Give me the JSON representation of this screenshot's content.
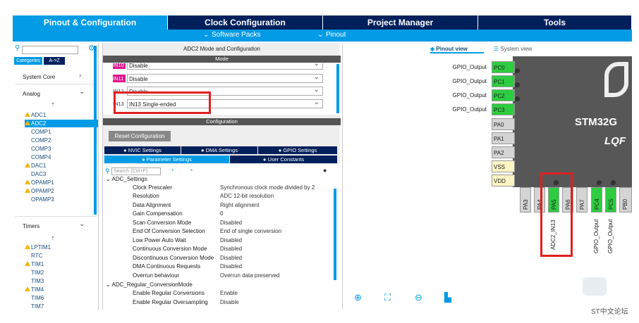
{
  "tabs": [
    "Pinout & Configuration",
    "Clock Configuration",
    "Project Manager",
    "Tools"
  ],
  "subbar": {
    "software_packs": "Software Packs",
    "pinout": "Pinout"
  },
  "left": {
    "tab_categories": "Categories",
    "tab_az": "A->Z",
    "system_core": "System Core",
    "analog": "Analog",
    "analog_items": [
      "ADC1",
      "ADC2",
      "COMP1",
      "COMP2",
      "COMP3",
      "COMP4",
      "DAC1",
      "DAC3",
      "OPAMP1",
      "OPAMP2",
      "OPAMP3"
    ],
    "timers": "Timers",
    "timer_items": [
      "LPTIM1",
      "RTC",
      "TIM1",
      "TIM2",
      "TIM3",
      "TIM4",
      "TIM6",
      "TIM7"
    ]
  },
  "mid": {
    "title": "ADC2 Mode and Configuration",
    "mode_label": "Mode",
    "mode_rows": [
      {
        "pin": "IN10",
        "value": "Disable"
      },
      {
        "pin": "IN11",
        "value": "Disable"
      },
      {
        "pin": "IN12",
        "value": "Disable"
      },
      {
        "pin": "IN13",
        "value": "IN13 Single-ended"
      }
    ],
    "config_label": "Configuration",
    "reset_btn": "Reset Configuration",
    "tabs_row1": [
      "NVIC Settings",
      "DMA Settings",
      "GPIO Settings"
    ],
    "tabs_row2": [
      "Parameter Settings",
      "User Constants"
    ],
    "search_placeholder": "Search (Ctrl+F)",
    "group1": "ADC_Settings",
    "params": [
      {
        "name": "Clock Prescaler",
        "value": "Synchronous clock mode divided by 2"
      },
      {
        "name": "Resolution",
        "value": "ADC 12-bit resolution"
      },
      {
        "name": "Data Alignment",
        "value": "Right alignment"
      },
      {
        "name": "Gain Compensation",
        "value": "0"
      },
      {
        "name": "Scan Conversion Mode",
        "value": "Disabled"
      },
      {
        "name": "End Of Conversion Selection",
        "value": "End of single conversion"
      },
      {
        "name": "Low Power Auto Wait",
        "value": "Disabled"
      },
      {
        "name": "Continuous Conversion Mode",
        "value": "Disabled"
      },
      {
        "name": "Discontinuous Conversion Mode",
        "value": "Disabled"
      },
      {
        "name": "DMA Continuous Requests",
        "value": "Disabled"
      },
      {
        "name": "Overrun behaviour",
        "value": "Overrun data preserved"
      }
    ],
    "group2": "ADC_Regular_ConversionMode",
    "params2": [
      {
        "name": "Enable Regular Conversions",
        "value": "Enable"
      },
      {
        "name": "Enable Regular Oversampling",
        "value": "Disable"
      }
    ]
  },
  "right": {
    "pinout_view": "Pinout view",
    "system_view": "System view",
    "chip_name": "STM32G",
    "chip_pkg": "LQF",
    "left_pins": [
      {
        "name": "PC0",
        "label": "GPIO_Output",
        "color": "green"
      },
      {
        "name": "PC1",
        "label": "GPIO_Output",
        "color": "green"
      },
      {
        "name": "PC2",
        "label": "GPIO_Output",
        "color": "green"
      },
      {
        "name": "PC3",
        "label": "GPIO_Output",
        "color": "green"
      },
      {
        "name": "PA0",
        "label": "",
        "color": "gray"
      },
      {
        "name": "PA1",
        "label": "",
        "color": "gray"
      },
      {
        "name": "PA2",
        "label": "",
        "color": "gray"
      },
      {
        "name": "VSS",
        "label": "",
        "color": "yellow"
      },
      {
        "name": "VDD",
        "label": "",
        "color": "yellow"
      }
    ],
    "bottom_pins": [
      {
        "name": "PA3",
        "color": "gray"
      },
      {
        "name": "PA4",
        "color": "gray"
      },
      {
        "name": "PA5",
        "color": "green"
      },
      {
        "name": "PA6",
        "color": "gray"
      },
      {
        "name": "PA7",
        "color": "gray"
      },
      {
        "name": "PC4",
        "color": "green"
      },
      {
        "name": "PC5",
        "color": "green"
      },
      {
        "name": "PB0",
        "color": "gray"
      }
    ],
    "bottom_labels": [
      "ADC2_IN13",
      "GPIO_Output",
      "GPIO_Output"
    ],
    "watermark": "ST中文论坛"
  }
}
